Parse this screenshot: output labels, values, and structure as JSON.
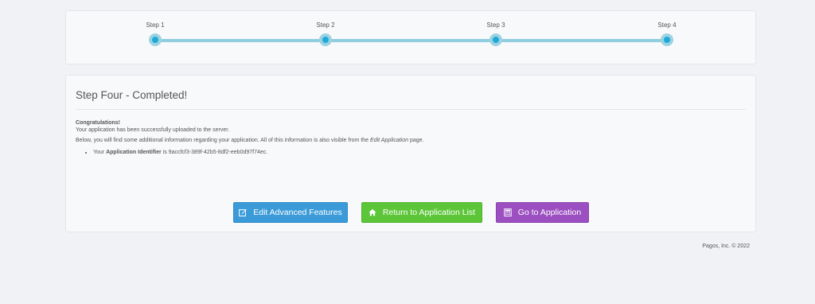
{
  "progress": {
    "steps": [
      {
        "label": "Step 1"
      },
      {
        "label": "Step 2"
      },
      {
        "label": "Step 3"
      },
      {
        "label": "Step 4"
      }
    ],
    "colors": {
      "track": "#8fcde0",
      "dot": "#1eaad8"
    }
  },
  "content": {
    "title": "Step Four - Completed!",
    "congrats_heading": "Congratulations!",
    "uploaded_text": "Your application has been successfully uploaded to the server.",
    "info_text_before": "Below, you will find some additional information regarding your application. All of this information is also visible from the ",
    "info_text_link": "Edit Application",
    "info_text_after": " page.",
    "identifier_prefix": "Your ",
    "identifier_label": "Application Identifier",
    "identifier_mid": " is ",
    "identifier_value": "9accfcf3-389f-42b5-8df2-eeb0d97f74ec."
  },
  "buttons": {
    "edit_features": {
      "label": "Edit Advanced Features",
      "icon": "edit-icon",
      "color": "#3b9bd9"
    },
    "return_list": {
      "label": "Return to Application List",
      "icon": "home-icon",
      "color": "#5cc638"
    },
    "go_app": {
      "label": "Go to Application",
      "icon": "calculator-icon",
      "color": "#9b4fc0"
    }
  },
  "footer": {
    "text": "Pagos, Inc. © 2022"
  }
}
